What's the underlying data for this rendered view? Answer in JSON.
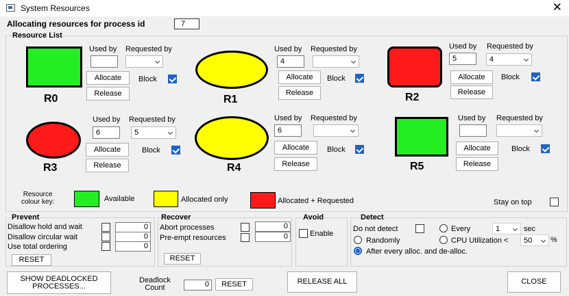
{
  "window": {
    "title": "System Resources",
    "close_glyph": "✕"
  },
  "top": {
    "label": "Allocating resources for process id",
    "process_id": "7"
  },
  "resource_list": {
    "title": "Resource List",
    "headers": {
      "used_by": "Used by",
      "requested_by": "Requested by"
    },
    "allocate_label": "Allocate",
    "release_label": "Release",
    "block_label": "Block",
    "resources": [
      {
        "name": "R0",
        "shape": "square",
        "color": "#22ee22",
        "used_by": "",
        "requested_by": "",
        "block": true
      },
      {
        "name": "R1",
        "shape": "circle",
        "color": "#ffff00",
        "used_by": "4",
        "requested_by": "",
        "block": true
      },
      {
        "name": "R2",
        "shape": "square",
        "color": "#ff1a1a",
        "used_by": "5",
        "requested_by": "4",
        "block": true
      },
      {
        "name": "R3",
        "shape": "circle",
        "color": "#ff1a1a",
        "used_by": "6",
        "requested_by": "5",
        "block": true
      },
      {
        "name": "R4",
        "shape": "circle",
        "color": "#ffff00",
        "used_by": "6",
        "requested_by": "",
        "block": true
      },
      {
        "name": "R5",
        "shape": "square",
        "color": "#22ee22",
        "used_by": "",
        "requested_by": "",
        "block": true
      }
    ]
  },
  "colour_key": {
    "label_line1": "Resource",
    "label_line2": "colour key:",
    "items": [
      {
        "label": "Available",
        "color": "#22ee22"
      },
      {
        "label": "Allocated only",
        "color": "#ffff00"
      },
      {
        "label": "Allocated + Requested",
        "color": "#ff1a1a"
      }
    ],
    "stay_on_top": "Stay on top"
  },
  "prevent": {
    "title": "Prevent",
    "rows": [
      {
        "label": "Disallow hold and wait",
        "value": "0"
      },
      {
        "label": "Disallow circular wait",
        "value": "0"
      },
      {
        "label": "Use total ordering",
        "value": "0"
      }
    ],
    "reset": "RESET"
  },
  "recover": {
    "title": "Recover",
    "rows": [
      {
        "label": "Abort processes",
        "value": "0"
      },
      {
        "label": "Pre-empt resources",
        "value": "0"
      }
    ],
    "reset": "RESET"
  },
  "avoid": {
    "title": "Avoid",
    "enable": "Enable"
  },
  "detect": {
    "title": "Detect",
    "do_not_detect": "Do not detect",
    "every": "Every",
    "every_value": "1",
    "sec": "sec",
    "randomly": "Randomly",
    "cpu": "CPU Utilization <",
    "cpu_value": "50",
    "percent": "%",
    "after_every": "After every alloc. and de-alloc."
  },
  "bottom": {
    "show_deadlocked_line1": "SHOW DEADLOCKED",
    "show_deadlocked_line2": "PROCESSES...",
    "deadlock_line1": "Deadlock",
    "deadlock_line2": "Count",
    "deadlock_count": "0",
    "reset": "RESET",
    "release_all": "RELEASE ALL",
    "close": "CLOSE"
  }
}
